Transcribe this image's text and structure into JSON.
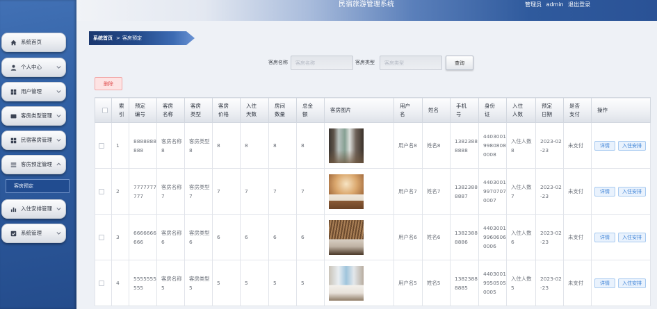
{
  "app": {
    "title": "民宿旅游管理系统",
    "role": "管理员",
    "username": "admin",
    "logout": "退出登录"
  },
  "theme": {
    "sidebar": "#2a5597",
    "accent": "#3c82d6",
    "danger": "#e05050"
  },
  "sidebar": {
    "items": [
      {
        "label": "系统首页",
        "icon": "home-icon",
        "has_submenu": false
      },
      {
        "label": "个人中心",
        "icon": "user-icon",
        "has_submenu": true,
        "expanded": false
      },
      {
        "label": "用户管理",
        "icon": "grid-icon",
        "has_submenu": true,
        "expanded": false
      },
      {
        "label": "客房类型管理",
        "icon": "card-icon",
        "has_submenu": true,
        "expanded": false
      },
      {
        "label": "民宿客房管理",
        "icon": "grid-icon",
        "has_submenu": true,
        "expanded": false
      },
      {
        "label": "客房预定管理",
        "icon": "list-icon",
        "has_submenu": true,
        "expanded": true,
        "children": [
          {
            "label": "客房预定",
            "active": true
          }
        ]
      },
      {
        "label": "入住安排管理",
        "icon": "bar-chart-icon",
        "has_submenu": true,
        "expanded": false
      },
      {
        "label": "系统管理",
        "icon": "check-square-icon",
        "has_submenu": true,
        "expanded": false
      }
    ]
  },
  "breadcrumb": {
    "home": "系统首页",
    "separator": ">",
    "current": "客房预定"
  },
  "search": {
    "name_label": "客房名称",
    "name_placeholder": "客房名称",
    "name_value": "",
    "type_label": "客房类型",
    "type_placeholder": "客房类型",
    "type_value": "",
    "query": "查询"
  },
  "toolbar": {
    "delete": "删除"
  },
  "table": {
    "headers": [
      "索引",
      "预定编号",
      "客房名称",
      "客房类型",
      "客房价格",
      "入住天数",
      "房间数量",
      "总金额",
      "客房图片",
      "用户名",
      "姓名",
      "手机号",
      "身份证",
      "入住人数",
      "预定日期",
      "是否支付",
      "操作"
    ],
    "rows": [
      {
        "index": "1",
        "booking_no": "8888888888",
        "room_name": "客房名称8",
        "room_type": "客房类型8",
        "room_price": "8",
        "stay_days": "8",
        "room_count": "8",
        "total_amount": "8",
        "username": "用户名8",
        "name": "姓名8",
        "phone": "13823888888",
        "id_card": "440300199808080008",
        "guest_count": "入住人数8",
        "booking_date": "2023-02-23",
        "paid": "未支付"
      },
      {
        "index": "2",
        "booking_no": "7777777777",
        "room_name": "客房名称7",
        "room_type": "客房类型7",
        "room_price": "7",
        "stay_days": "7",
        "room_count": "7",
        "total_amount": "7",
        "username": "用户名7",
        "name": "姓名7",
        "phone": "13823888887",
        "id_card": "440300199707070007",
        "guest_count": "入住人数7",
        "booking_date": "2023-02-23",
        "paid": "未支付"
      },
      {
        "index": "3",
        "booking_no": "6666666666",
        "room_name": "客房名称6",
        "room_type": "客房类型6",
        "room_price": "6",
        "stay_days": "6",
        "room_count": "6",
        "total_amount": "6",
        "username": "用户名6",
        "name": "姓名6",
        "phone": "13823888886",
        "id_card": "440300199606060006",
        "guest_count": "入住人数6",
        "booking_date": "2023-02-23",
        "paid": "未支付"
      },
      {
        "index": "4",
        "booking_no": "5555555555",
        "room_name": "客房名称5",
        "room_type": "客房类型5",
        "room_price": "5",
        "stay_days": "5",
        "room_count": "5",
        "total_amount": "5",
        "username": "用户名5",
        "name": "姓名5",
        "phone": "13823888885",
        "id_card": "440300199505050005",
        "guest_count": "入住人数5",
        "booking_date": "2023-02-23",
        "paid": "未支付"
      }
    ],
    "actions": {
      "detail": "详情",
      "checkin": "入住安排"
    }
  }
}
